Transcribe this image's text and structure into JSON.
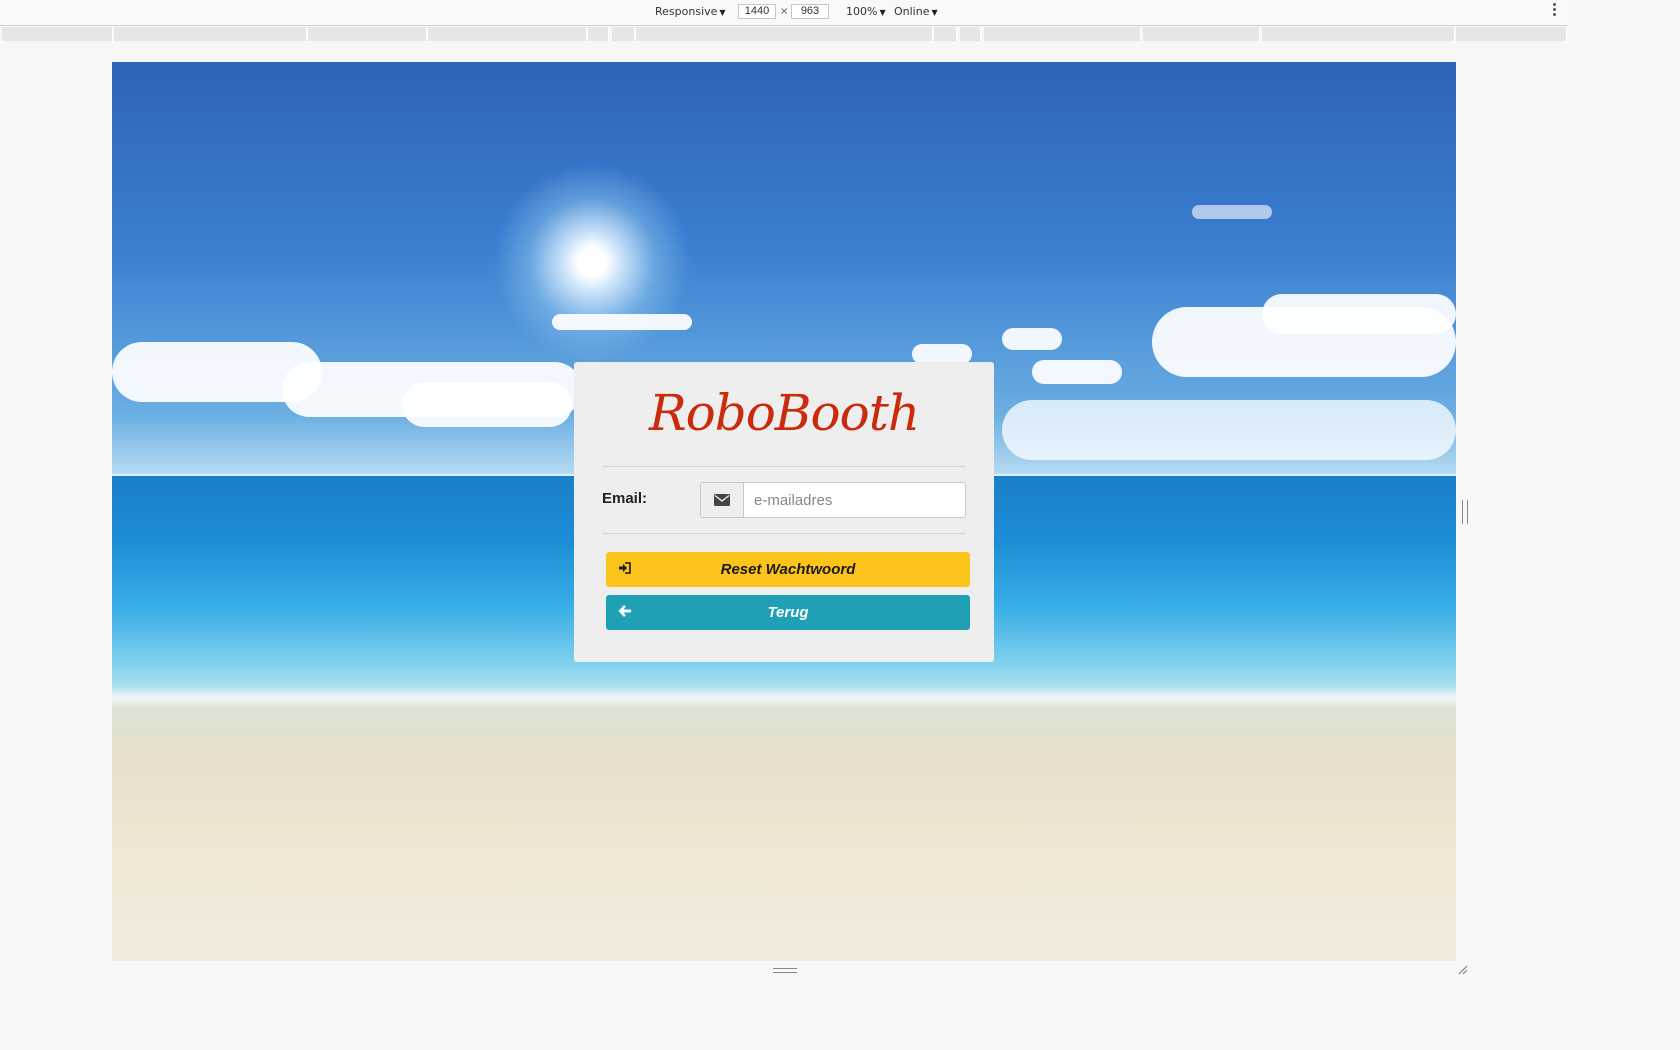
{
  "devtools": {
    "device_mode": "Responsive",
    "width": "1440",
    "height": "963",
    "times_symbol": "×",
    "zoom": "100%",
    "network": "Online"
  },
  "login_card": {
    "brand": "RoboBooth",
    "email_label": "Email:",
    "email_placeholder": "e-mailadres",
    "email_value": "",
    "reset_button_label": "Reset Wachtwoord",
    "back_button_label": "Terug"
  },
  "colors": {
    "brand": "#cc2a0c",
    "reset_button": "#fcc31b",
    "back_button": "#20a0b4",
    "card_background": "#eeeeee"
  },
  "icons": {
    "email_addon": "envelope-icon",
    "reset_button": "sign-in-icon",
    "back_button": "arrow-left-icon"
  }
}
